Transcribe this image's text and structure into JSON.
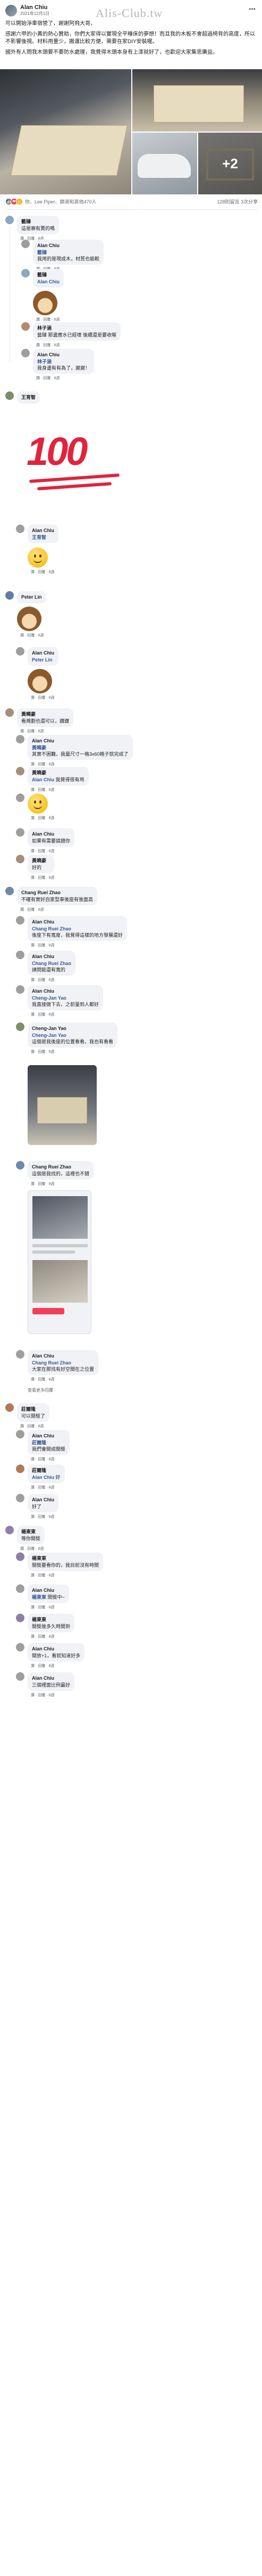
{
  "watermark": "Alis-Club.tw",
  "post": {
    "author": "Alan Chiu",
    "time": "2021年12月1日 ·",
    "paragraphs": [
      "可以開始淨車宿營了，謝謝阿飛大哥，",
      "感謝六甲的小黃的熱心贊助，你們大家得以實現全平睡床的夢想！而且我的木板不會超過椅背的高度，所以不影響後視。材料用量少，搬運比較方便，需要在家DIY安裝喔。",
      "國外有人問我木頭要不要防水處理，我覺得木頭本身有上漆就好了，也歡迎大家集思廣益。"
    ],
    "more_photos": "+2",
    "reactions_summary": "你、Lee Piper、錦淑和其他470人",
    "counts": "128則留言  3次分享"
  },
  "colors": {
    "like": "#1877f2",
    "love": "#f33e58",
    "care": "#f7b125",
    "accent_link": "#385898",
    "red_100": "#e0243c"
  },
  "comments": [
    {
      "name": "藝臻",
      "text": "這是嘛有賣的嗎",
      "actions": "讚 · 回覆 · 8週"
    },
    {
      "name": "Alan Chiu",
      "tag": "藝臻",
      "text": "我用的是現成木，材質也能較",
      "actions": "讚 · 回覆 · 8週"
    },
    {
      "name": "藝臻",
      "tag": "Alan Chiu",
      "text": "",
      "actions": "讚 · 回覆 · 8週"
    },
    {
      "name": "林子涵",
      "tag": "藝臻",
      "text": "藝臻 那邊應水已經壞 後續還是要收喔",
      "actions": "讚 · 回覆 · 8週"
    },
    {
      "name": "Alan Chiu",
      "tag": "林子涵",
      "text": "我身邊有有為了，謝謝！",
      "actions": "讚 · 回覆 · 8週"
    },
    {
      "name": "王育智",
      "text": "",
      "actions": "讚 · 回覆 · 8週"
    },
    {
      "name": "Alan Chiu",
      "tag": "王育智",
      "text": "",
      "actions": "讚 · 回覆 · 8週"
    },
    {
      "name": "Peter Lin",
      "text": "",
      "actions": "讚 · 回覆 · 8週"
    },
    {
      "name": "Alan Chiu",
      "tag": "Peter Lin",
      "text": "",
      "actions": "讚 · 回覆 · 8週"
    },
    {
      "name": "黃曉豪",
      "text": "看規劃也還可以，讚讚",
      "actions": "讚 · 回覆 · 8週"
    },
    {
      "name": "Alan Chiu",
      "tag": "黃曉豪",
      "text": "其實不困難，我量尺寸一格3x60格子就完成了",
      "actions": "讚 · 回覆 · 8週"
    },
    {
      "name": "黃曉豪",
      "tag": "Alan Chiu",
      "text": "我覺得很有用",
      "actions": "讚 · 回覆 · 8週"
    },
    {
      "name": "Alan Chiu",
      "tag": "",
      "text": "",
      "actions": "讚 · 回覆 · 8週"
    },
    {
      "name": "Alan Chiu",
      "tag": "",
      "text": "如果有需要搞錯你",
      "actions": "讚 · 回覆 · 8週"
    },
    {
      "name": "黃曉豪",
      "tag": "",
      "text": "好的",
      "actions": "讚 · 回覆 · 8週"
    },
    {
      "name": "Chang Ruei Zhao",
      "text": "不確有實好自家型車後座有後面高",
      "actions": "讚 · 回覆 · 8週"
    },
    {
      "name": "Alan Chiu",
      "tag": "Chang Ruei Zhao",
      "text": "後座下有寬度，我覺得這樣的地方發展還好",
      "actions": "讚 · 回覆 · 8週"
    },
    {
      "name": "Alan Chiu",
      "tag": "Chang Ruei Zhao",
      "text": "請問能還有寬的",
      "actions": "讚 · 回覆 · 8週"
    },
    {
      "name": "Alan Chiu",
      "tag": "Cheng-Jan Yao",
      "text": "我直接做下去，之前量到人都好",
      "actions": "讚 · 回覆 · 8週"
    },
    {
      "name": "Cheng-Jan Yao",
      "tag": "Cheng-Jan Yao",
      "text": "這個是我後座的位置看看，我也有看看",
      "actions": "讚 · 回覆 · 8週"
    },
    {
      "name": "Chang Ruei Zhao",
      "tag": "",
      "text": "這個是我找的，這裡也不錯",
      "actions": "讚 · 回覆 · 8週"
    },
    {
      "name": "Alan Chiu",
      "tag": "Chang Ruei Zhao",
      "text": "大家在那找有好空間在之位置",
      "actions": "讚 · 回覆 · 8週"
    },
    {
      "name": "莊爾隆",
      "text": "可以開獎了",
      "actions": "讚 · 回覆 · 8週"
    },
    {
      "name": "Alan Chiu",
      "tag": "莊爾隆",
      "text": "我們會開成開獎",
      "actions": "讚 · 回覆 · 8週"
    },
    {
      "name": "莊爾隆",
      "tag": "Alan Chiu",
      "text": "好",
      "actions": "讚 · 回覆 · 8週"
    },
    {
      "name": "Alan Chiu",
      "tag": "",
      "text": "好了",
      "actions": "讚 · 回覆 · 8週"
    },
    {
      "name": "楊東東",
      "text": "等你開獎",
      "actions": "讚 · 回覆 · 8週"
    },
    {
      "name": "楊東東",
      "text": "開獎要看你的，我目前沒有時間",
      "actions": "讚 · 回覆 · 8週"
    },
    {
      "name": "Alan Chiu",
      "tag": "楊東東",
      "text": "開獎中~",
      "actions": "讚 · 回覆 · 8週"
    },
    {
      "name": "楊東東",
      "tag": "",
      "text": "開獎後多久時間到",
      "actions": "讚 · 回覆 · 8週"
    },
    {
      "name": "Alan Chiu",
      "tag": "",
      "text": "開放+1，看就知道好多",
      "actions": "讚 · 回覆 · 8週"
    },
    {
      "name": "Alan Chiu",
      "tag": "",
      "text": "三個裡面比例最好",
      "actions": "讚 · 回覆 · 8週"
    }
  ],
  "labels": {
    "hundred": "100",
    "view_more": "查看更多回覆"
  }
}
